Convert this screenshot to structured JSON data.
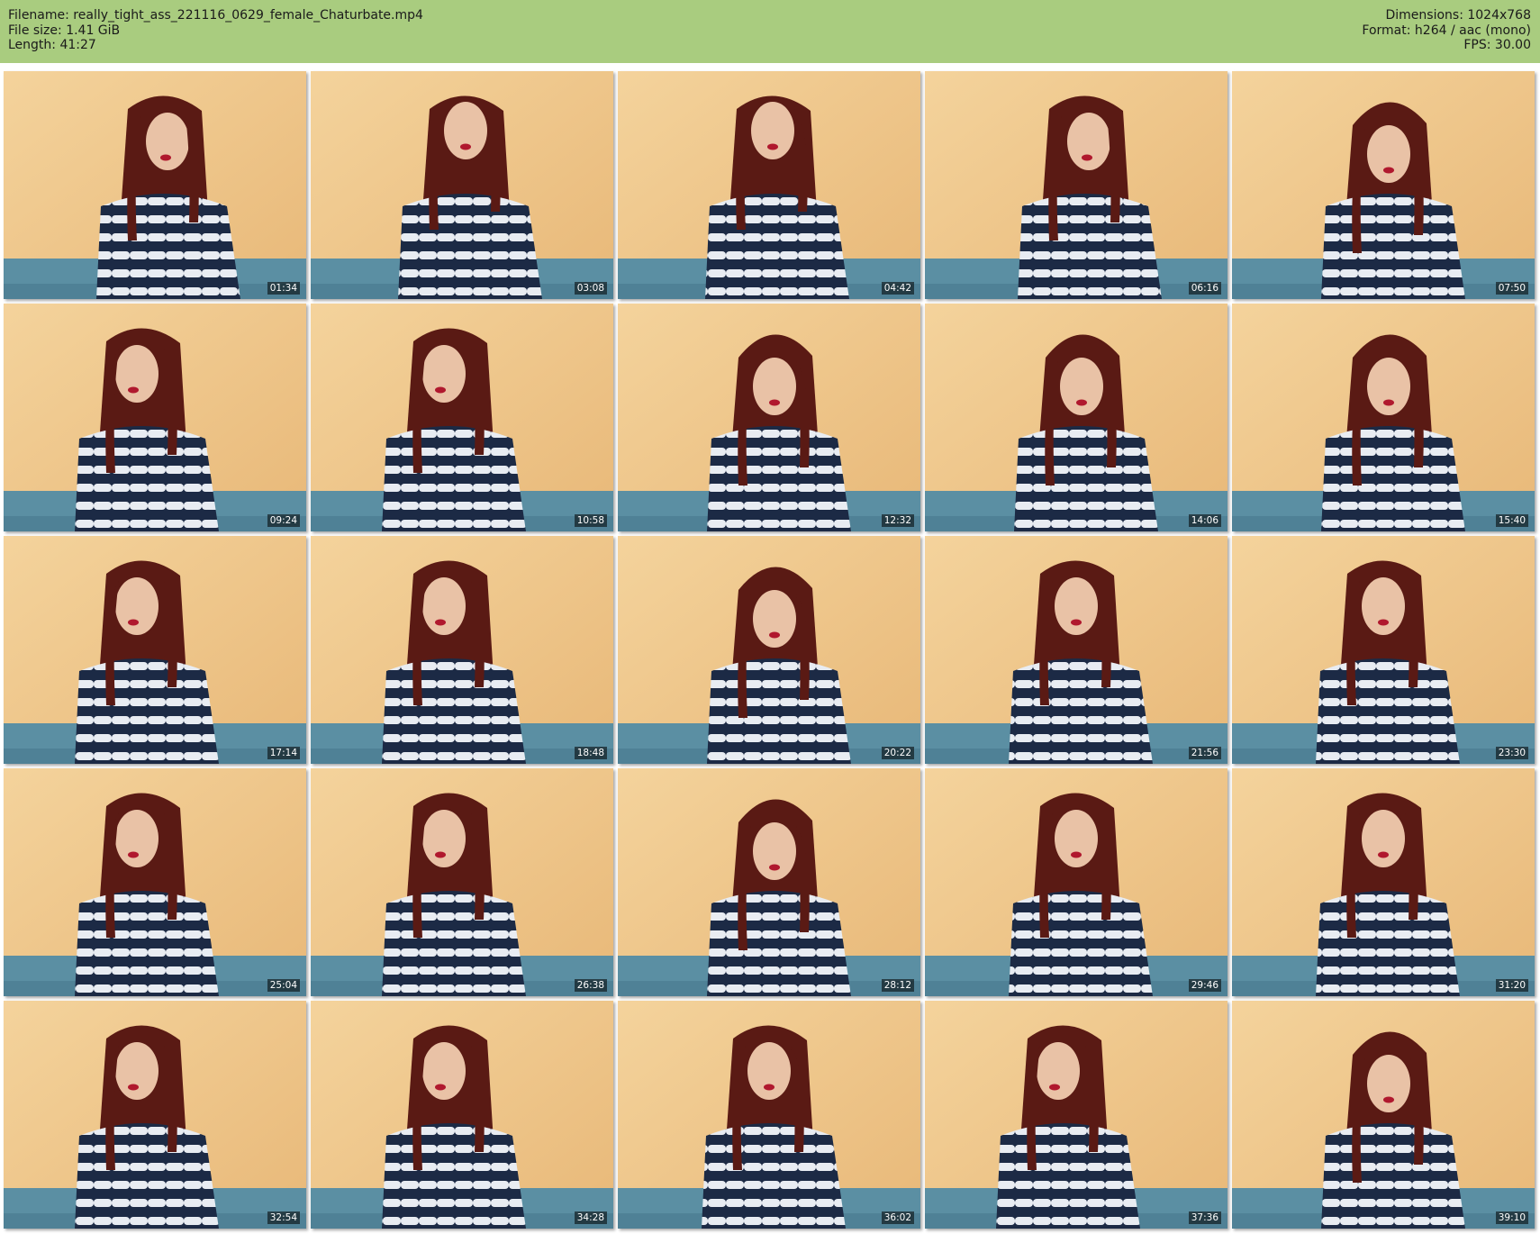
{
  "header": {
    "filename": "Filename: really_tight_ass_221116_0629_female_Chaturbate.mp4",
    "filesize": "File size: 1.41 GiB",
    "length": "Length: 41:27",
    "dimensions": "Dimensions: 1024x768",
    "format": "Format: h264 / aac (mono)",
    "fps": "FPS: 30.00"
  },
  "colors": {
    "header_bg": "#a9cc7f",
    "wall": "#eec58a",
    "couch": "#5b8fa3",
    "hair": "#5a1a14",
    "sweater_dark": "#1c2a45",
    "sweater_light": "#e8ecf2"
  },
  "thumbnails": [
    {
      "time": "01:34",
      "pose": "right"
    },
    {
      "time": "03:08",
      "pose": "up"
    },
    {
      "time": "04:42",
      "pose": "up"
    },
    {
      "time": "06:16",
      "pose": "right"
    },
    {
      "time": "07:50",
      "pose": "down"
    },
    {
      "time": "09:24",
      "pose": "left"
    },
    {
      "time": "10:58",
      "pose": "left"
    },
    {
      "time": "12:32",
      "pose": "down"
    },
    {
      "time": "14:06",
      "pose": "down"
    },
    {
      "time": "15:40",
      "pose": "down"
    },
    {
      "time": "17:14",
      "pose": "left"
    },
    {
      "time": "18:48",
      "pose": "left"
    },
    {
      "time": "20:22",
      "pose": "down"
    },
    {
      "time": "21:56",
      "pose": "front"
    },
    {
      "time": "23:30",
      "pose": "front"
    },
    {
      "time": "25:04",
      "pose": "left"
    },
    {
      "time": "26:38",
      "pose": "left"
    },
    {
      "time": "28:12",
      "pose": "down"
    },
    {
      "time": "29:46",
      "pose": "front"
    },
    {
      "time": "31:20",
      "pose": "front"
    },
    {
      "time": "32:54",
      "pose": "left"
    },
    {
      "time": "34:28",
      "pose": "left"
    },
    {
      "time": "36:02",
      "pose": "front"
    },
    {
      "time": "37:36",
      "pose": "left"
    },
    {
      "time": "39:10",
      "pose": "down"
    }
  ]
}
